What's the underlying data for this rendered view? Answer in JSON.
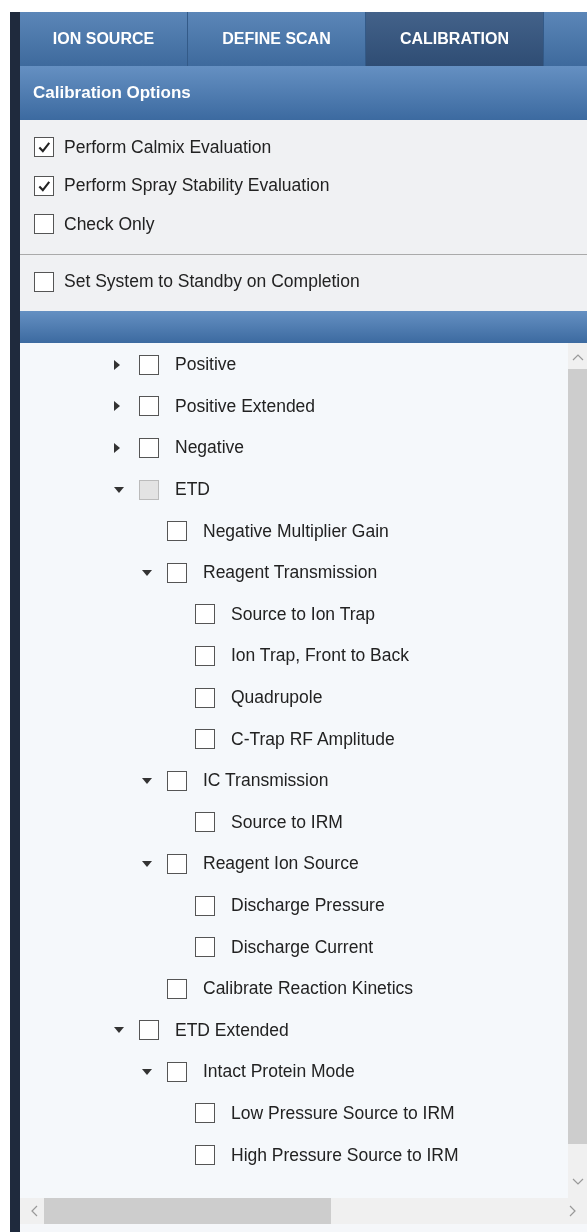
{
  "tabs": [
    {
      "label": "ION SOURCE",
      "selected": false
    },
    {
      "label": "DEFINE SCAN",
      "selected": false
    },
    {
      "label": "CALIBRATION",
      "selected": true
    }
  ],
  "options": {
    "title": "Calibration Options",
    "items": [
      {
        "label": "Perform Calmix Evaluation",
        "checked": true
      },
      {
        "label": "Perform Spray Stability Evaluation",
        "checked": true
      },
      {
        "label": "Check Only",
        "checked": false
      }
    ],
    "standby": {
      "label": "Set System to Standby on Completion",
      "checked": false
    }
  },
  "tree": {
    "items": [
      {
        "kind": "group",
        "label": "Positive",
        "checked": false,
        "indeterminate": false,
        "expanded": false
      },
      {
        "kind": "group",
        "label": "Positive Extended",
        "checked": false,
        "indeterminate": false,
        "expanded": false
      },
      {
        "kind": "group",
        "label": "Negative",
        "checked": false,
        "indeterminate": false,
        "expanded": false
      },
      {
        "kind": "group",
        "label": "ETD",
        "checked": false,
        "indeterminate": true,
        "expanded": true,
        "children": [
          {
            "kind": "leaf",
            "label": "Negative Multiplier Gain",
            "checked": false,
            "indeterminate": false
          },
          {
            "kind": "group",
            "label": "Reagent Transmission",
            "checked": false,
            "indeterminate": false,
            "expanded": true,
            "children": [
              {
                "kind": "leaf",
                "label": "Source to Ion Trap",
                "checked": false,
                "indeterminate": false
              },
              {
                "kind": "leaf",
                "label": "Ion Trap, Front to Back",
                "checked": false,
                "indeterminate": false
              },
              {
                "kind": "leaf",
                "label": "Quadrupole",
                "checked": false,
                "indeterminate": false
              },
              {
                "kind": "leaf",
                "label": "C-Trap RF Amplitude",
                "checked": false,
                "indeterminate": false
              }
            ]
          },
          {
            "kind": "group",
            "label": "IC Transmission",
            "checked": false,
            "indeterminate": false,
            "expanded": true,
            "children": [
              {
                "kind": "leaf",
                "label": "Source to IRM",
                "checked": false,
                "indeterminate": false
              }
            ]
          },
          {
            "kind": "group",
            "label": "Reagent Ion Source",
            "checked": false,
            "indeterminate": false,
            "expanded": true,
            "children": [
              {
                "kind": "leaf",
                "label": "Discharge Pressure",
                "checked": false,
                "indeterminate": false
              },
              {
                "kind": "leaf",
                "label": "Discharge Current",
                "checked": false,
                "indeterminate": false
              }
            ]
          },
          {
            "kind": "leaf",
            "label": "Calibrate Reaction Kinetics",
            "checked": false,
            "indeterminate": false
          }
        ]
      },
      {
        "kind": "group",
        "label": "ETD Extended",
        "checked": false,
        "indeterminate": false,
        "expanded": true,
        "children": [
          {
            "kind": "group",
            "label": "Intact Protein Mode",
            "checked": false,
            "indeterminate": false,
            "expanded": true,
            "children": [
              {
                "kind": "leaf",
                "label": "Low Pressure Source to IRM",
                "checked": false,
                "indeterminate": false
              },
              {
                "kind": "leaf",
                "label": "High Pressure Source to IRM",
                "checked": false,
                "indeterminate": false
              }
            ]
          }
        ]
      }
    ]
  }
}
